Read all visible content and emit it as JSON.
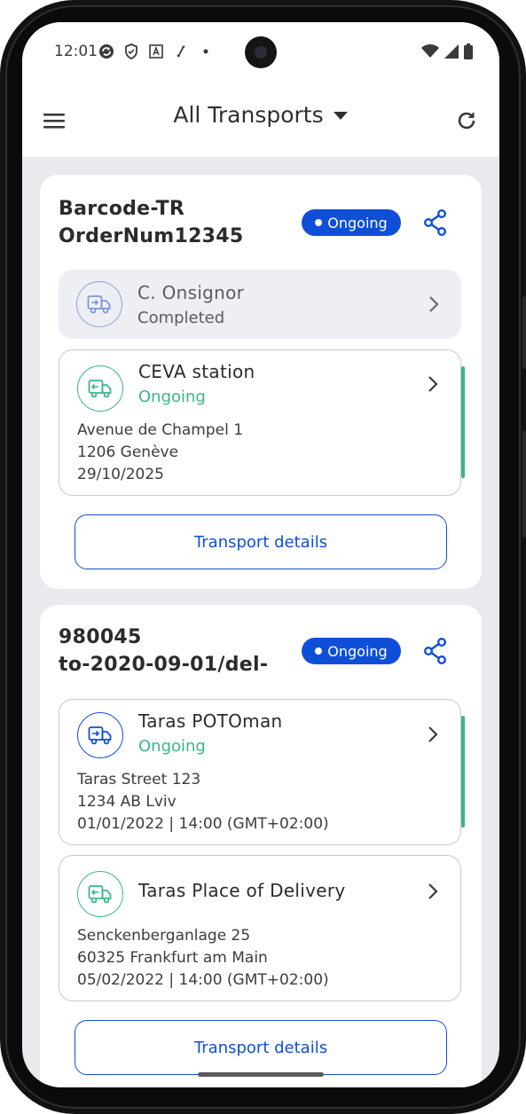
{
  "status_bar": {
    "time": "12:01"
  },
  "header": {
    "title": "All Transports"
  },
  "colors": {
    "primary": "#0f4fd8",
    "success": "#3bb58a",
    "background": "#e9e9ee"
  },
  "transports": [
    {
      "title_line1": "Barcode-TR",
      "title_line2": "OrderNum12345",
      "badge": "Ongoing",
      "stops": [
        {
          "name": "C. Onsignor",
          "status": "Completed",
          "icon": "truck-pickup-icon"
        },
        {
          "name": "CEVA station",
          "status": "Ongoing",
          "icon": "truck-delivery-icon",
          "address_line1": "Avenue de Champel 1",
          "address_line2": "1206 Genève",
          "date": "29/10/2025"
        }
      ],
      "details_label": "Transport details"
    },
    {
      "title_line1": "980045",
      "title_line2": "to-2020-09-01/del-",
      "badge": "Ongoing",
      "stops": [
        {
          "name": "Taras POTOman",
          "status": "Ongoing",
          "icon": "truck-pickup-icon",
          "address_line1": "Taras Street 123",
          "address_line2": "1234 AB Lviv",
          "date": "01/01/2022 | 14:00 (GMT+02:00)"
        },
        {
          "name": "Taras Place of Delivery",
          "icon": "truck-delivery-icon",
          "address_line1": "Senckenberganlage 25",
          "address_line2": "60325 Frankfurt am Main",
          "date": "05/02/2022 | 14:00 (GMT+02:00)"
        }
      ],
      "details_label": "Transport details"
    }
  ]
}
